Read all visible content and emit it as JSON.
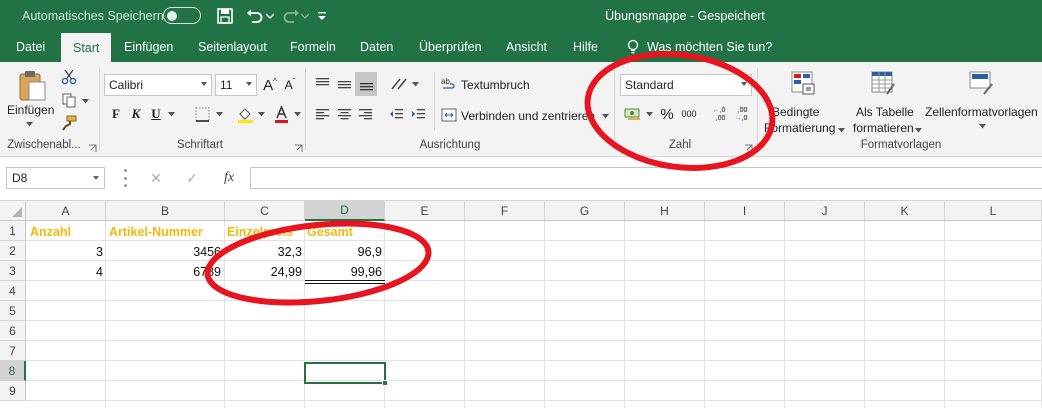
{
  "titlebar": {
    "autosave_label": "Automatisches Speichern",
    "document_title": "Übungsmappe  -  Gespeichert"
  },
  "tabs": [
    "Datei",
    "Start",
    "Einfügen",
    "Seitenlayout",
    "Formeln",
    "Daten",
    "Überprüfen",
    "Ansicht",
    "Hilfe"
  ],
  "active_tab": "Start",
  "tell_me": "Was möchten Sie tun?",
  "ribbon": {
    "clipboard": {
      "paste": "Einfügen",
      "label": "Zwischenabl..."
    },
    "font": {
      "name": "Calibri",
      "size": "11",
      "bold": "F",
      "italic": "K",
      "underline": "U",
      "grow": "A",
      "shrink": "A",
      "label": "Schriftart"
    },
    "alignment": {
      "wrap": "Textumbruch",
      "merge": "Verbinden und zentrieren",
      "label": "Ausrichtung"
    },
    "number": {
      "format": "Standard",
      "percent": "%",
      "thousands": "000",
      "inc_decimal": ",00",
      "dec_decimal": ",00",
      "label": "Zahl"
    },
    "styles": {
      "conditional_1": "Bedingte",
      "conditional_2": "Formatierung",
      "table_1": "Als Tabelle",
      "table_2": "formatieren",
      "cell_styles": "Zellenformatvorlagen",
      "label": "Formatvorlagen"
    }
  },
  "formula_bar": {
    "name_box": "D8",
    "fx": "fx",
    "cancel": "✕",
    "enter": "✓",
    "value": ""
  },
  "columns": [
    "A",
    "B",
    "C",
    "D",
    "E",
    "F",
    "G",
    "H",
    "I",
    "J",
    "K",
    "L"
  ],
  "rows": [
    "1",
    "2",
    "3",
    "4",
    "5",
    "6",
    "7",
    "8",
    "9"
  ],
  "selected_cell": {
    "column": "D",
    "row": "8"
  },
  "cells": {
    "A1": "Anzahl",
    "B1": "Artikel-Nummer",
    "C1": "Einzelpreis",
    "D1": "Gesamt",
    "A2": "3",
    "B2": "3456",
    "C2": "32,3",
    "D2": "96,9",
    "A3": "4",
    "B3": "6789",
    "C3": "24,99",
    "D3": "99,96"
  },
  "colors": {
    "excel_green": "#217346",
    "header_text": "#f2b90c",
    "annotation": "#e8141f"
  }
}
